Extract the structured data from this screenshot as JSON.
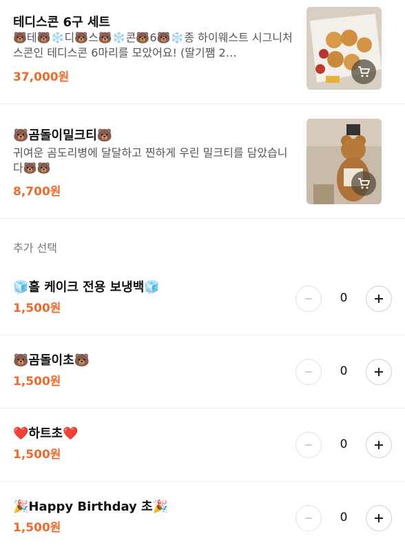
{
  "products": [
    {
      "title": "테디스콘 6구 세트",
      "description": "🐻테🐻❄️디🐻스🐻❄️콘🐻6🐻❄️종 하이웨스트 시그니처 스콘인 테디스콘 6마리를 모았어요! (딸기쨈 2…",
      "price": "37,000원",
      "image_icon": "scone-box-photo",
      "cart_icon": "cart-icon"
    },
    {
      "title": "🐻곰돌이밀크티🐻",
      "description": "귀여운 곰도리병에 달달하고 찐하게 우린 밀크티를 담았습니다🐻🐻",
      "price": "8,700원",
      "image_icon": "bear-bottle-photo",
      "cart_icon": "cart-icon"
    }
  ],
  "section_label": "추가 선택",
  "options": [
    {
      "name": "🧊홀 케이크 전용 보냉백🧊",
      "price": "1,500원",
      "quantity": "0"
    },
    {
      "name": "🐻곰돌이초🐻",
      "price": "1,500원",
      "quantity": "0"
    },
    {
      "name": "❤️하트초❤️",
      "price": "1,500원",
      "quantity": "0"
    },
    {
      "name": "🎉Happy Birthday 초🎉",
      "price": "1,500원",
      "quantity": "0"
    }
  ],
  "colors": {
    "price": "#f26a2a",
    "divider": "#ececec"
  }
}
